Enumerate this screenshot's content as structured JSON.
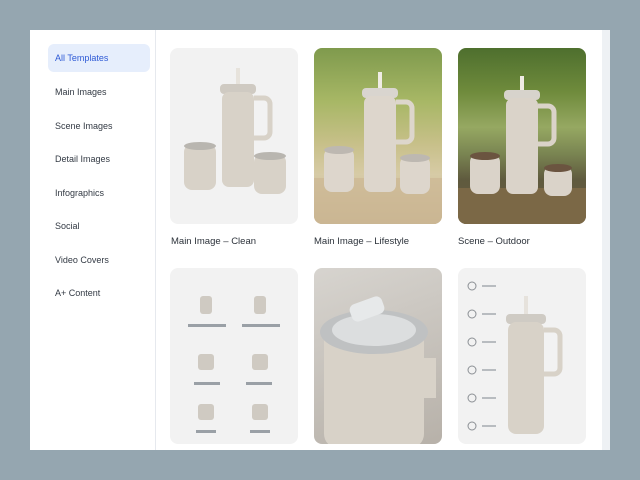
{
  "sidebar": {
    "items": [
      {
        "label": "All Templates",
        "active": true
      },
      {
        "label": "Main Images",
        "active": false
      },
      {
        "label": "Scene Images",
        "active": false
      },
      {
        "label": "Detail Images",
        "active": false
      },
      {
        "label": "Infographics",
        "active": false
      },
      {
        "label": "Social",
        "active": false
      },
      {
        "label": "Video Covers",
        "active": false
      },
      {
        "label": "A+ Content",
        "active": false
      }
    ]
  },
  "templates": [
    {
      "label": "Main Image – Clean"
    },
    {
      "label": "Main Image – Lifestyle"
    },
    {
      "label": "Scene – Outdoor"
    },
    {
      "label": ""
    },
    {
      "label": ""
    },
    {
      "label": ""
    }
  ],
  "colors": {
    "accent": "#2f5bd6",
    "active_bg": "#e6eefc",
    "product": "#d8d2c8"
  }
}
